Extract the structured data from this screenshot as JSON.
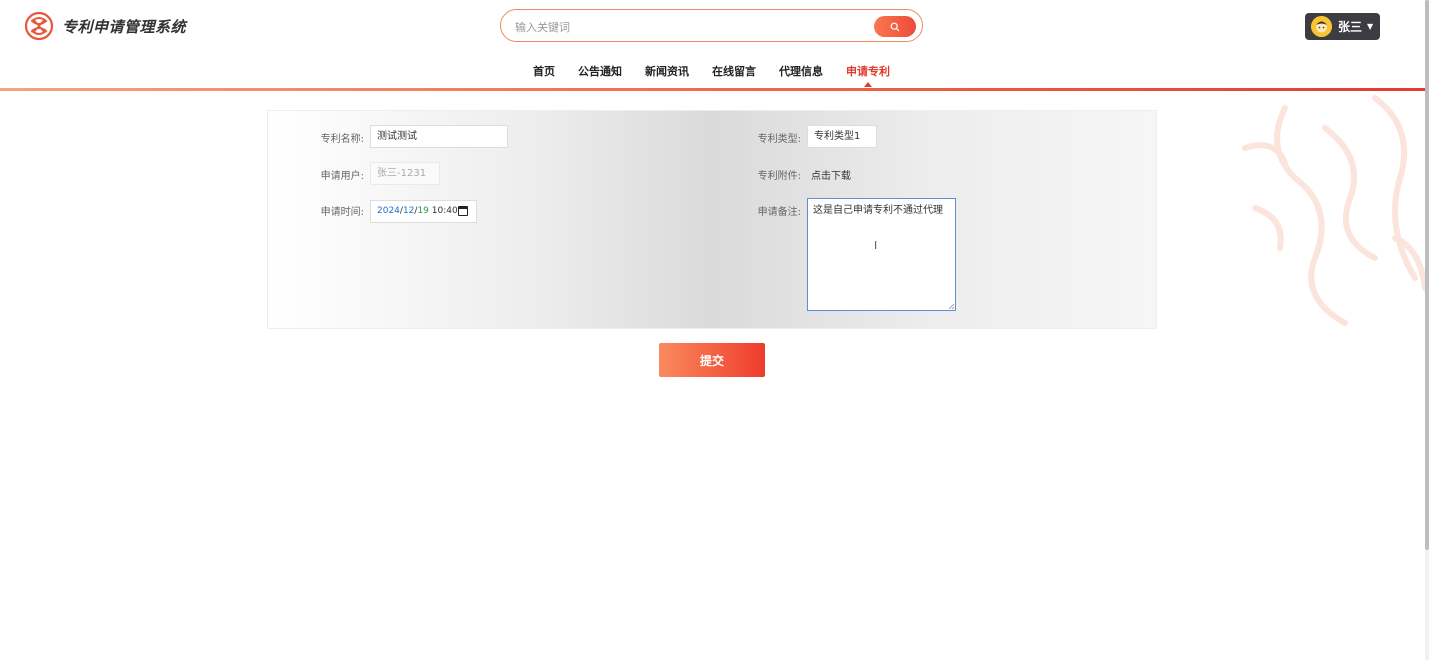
{
  "app": {
    "title": "专利申请管理系统"
  },
  "search": {
    "placeholder": "输入关键词"
  },
  "user": {
    "name": "张三"
  },
  "nav": {
    "items": [
      {
        "label": "首页"
      },
      {
        "label": "公告通知"
      },
      {
        "label": "新闻资讯"
      },
      {
        "label": "在线留言"
      },
      {
        "label": "代理信息"
      },
      {
        "label": "申请专利"
      }
    ],
    "active": "申请专利"
  },
  "form": {
    "patent_name": {
      "label": "专利名称:",
      "value": "测试测试"
    },
    "patent_type": {
      "label": "专利类型:",
      "value": "专利类型1"
    },
    "applicant": {
      "label": "申请用户:",
      "value": "张三-1231"
    },
    "attachment": {
      "label": "专利附件:",
      "link": "点击下载"
    },
    "apply_time": {
      "label": "申请时间:",
      "year": "2024",
      "month": "12",
      "day": "19",
      "time": "10:40"
    },
    "remark": {
      "label": "申请备注:",
      "value": "这是自己申请专利不通过代理"
    }
  },
  "submit": {
    "label": "提交"
  },
  "colors": {
    "accent": "#e3392b",
    "gradient_start": "#fa8a5e",
    "gradient_end": "#ee3c2c",
    "user_bg": "#3c3c42"
  }
}
